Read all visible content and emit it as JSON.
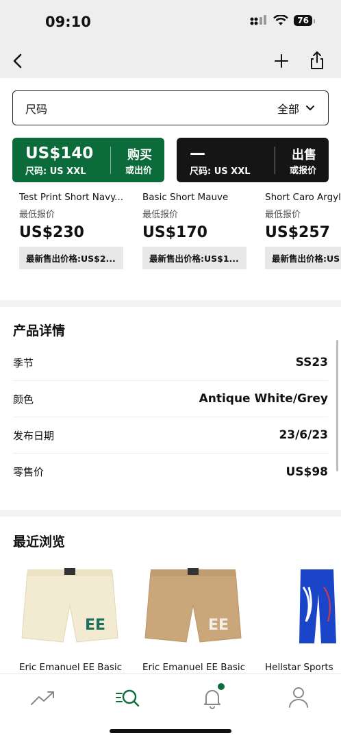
{
  "status": {
    "time": "09:10",
    "battery": "76"
  },
  "filter": {
    "label": "尺码",
    "value": "全部"
  },
  "buy": {
    "price": "US$140",
    "size": "尺码: US XXL",
    "action": "购买",
    "sub": "或出价"
  },
  "sell": {
    "price": "—",
    "size": "尺码: US XXL",
    "action": "出售",
    "sub": "或报价"
  },
  "related": [
    {
      "name": "Test Print Short Navy...",
      "label": "最低报价",
      "price": "US$230",
      "last": "最新售出价格:US$2..."
    },
    {
      "name": "Basic Short Mauve",
      "label": "最低报价",
      "price": "US$170",
      "last": "最新售出价格:US$1..."
    },
    {
      "name": "Short Caro Argyle",
      "label": "最低报价",
      "price": "US$257",
      "last": "最新售出价格:US"
    }
  ],
  "details": {
    "title": "产品详情",
    "rows": [
      {
        "key": "季节",
        "value": "SS23"
      },
      {
        "key": "颜色",
        "value": "Antique White/Grey"
      },
      {
        "key": "发布日期",
        "value": "23/6/23"
      },
      {
        "key": "零售价",
        "value": "US$98"
      }
    ]
  },
  "recent": {
    "title": "最近浏览",
    "items": [
      {
        "name": "Eric Emanuel EE Basic",
        "color": "#f3ead2"
      },
      {
        "name": "Eric Emanuel EE Basic",
        "color": "#c9a77a"
      },
      {
        "name": "Hellstar Sports",
        "color": "#1a45c9"
      }
    ]
  },
  "tabs": [
    "trending-icon",
    "search-icon",
    "notifications-icon",
    "profile-icon"
  ],
  "colors": {
    "accent": "#0b6b3a",
    "dark": "#151515"
  }
}
